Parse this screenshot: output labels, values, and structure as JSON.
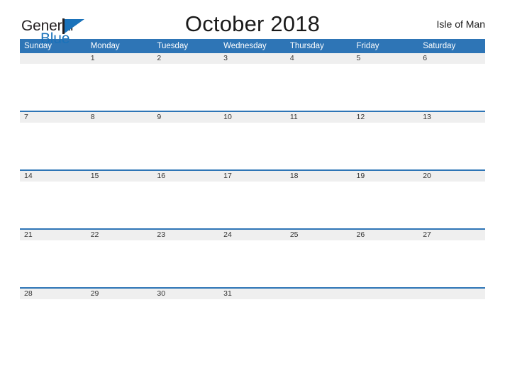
{
  "brand": {
    "name_part1": "General",
    "name_part2": "Blue",
    "color_dark": "#231f20",
    "color_blue": "#1a72ba"
  },
  "header": {
    "title": "October 2018",
    "locale": "Isle of Man"
  },
  "theme": {
    "header_row_bg": "#2e75b6",
    "date_band_bg": "#efefef",
    "row_divider": "#2e75b6",
    "page_bg": "#ffffff",
    "text": "#333333"
  },
  "calendar": {
    "month": "October",
    "year": "2018",
    "weekday_headers": [
      "Sunday",
      "Monday",
      "Tuesday",
      "Wednesday",
      "Thursday",
      "Friday",
      "Saturday"
    ],
    "weeks": [
      [
        "",
        "1",
        "2",
        "3",
        "4",
        "5",
        "6"
      ],
      [
        "7",
        "8",
        "9",
        "10",
        "11",
        "12",
        "13"
      ],
      [
        "14",
        "15",
        "16",
        "17",
        "18",
        "19",
        "20"
      ],
      [
        "21",
        "22",
        "23",
        "24",
        "25",
        "26",
        "27"
      ],
      [
        "28",
        "29",
        "30",
        "31",
        "",
        "",
        ""
      ]
    ]
  }
}
